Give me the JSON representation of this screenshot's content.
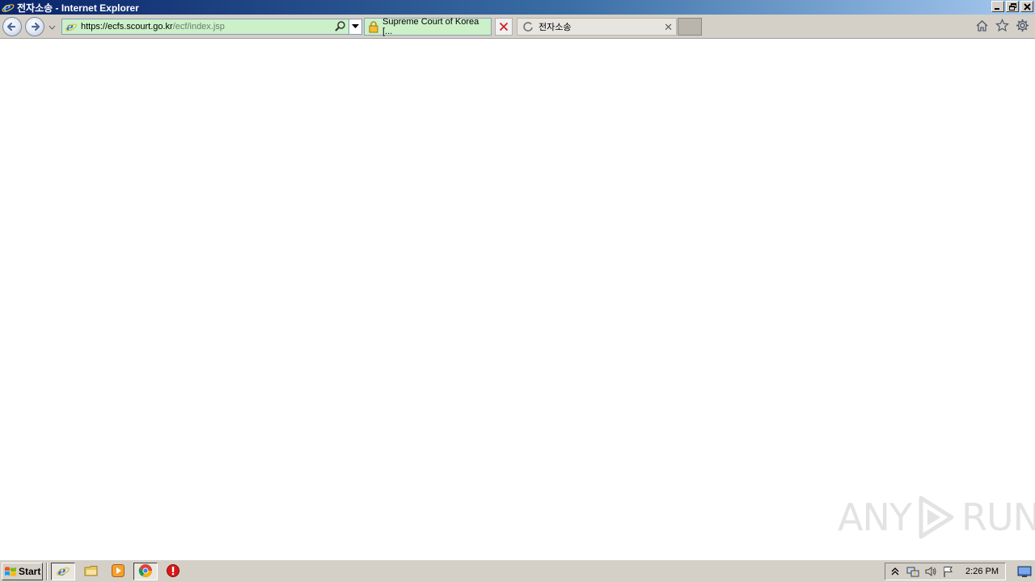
{
  "window": {
    "title": "전자소송 - Internet Explorer"
  },
  "address": {
    "url_host": "https://ecfs.scourt.go.kr",
    "url_path": "/ecf/index.jsp"
  },
  "tabs": [
    {
      "label": "Supreme Court of Korea [...",
      "state": "active"
    },
    {
      "label": "전자소송",
      "state": "loading"
    }
  ],
  "watermark": {
    "left_text": "ANY",
    "right_text": "RUN"
  },
  "taskbar": {
    "start_label": "Start",
    "clock": "2:26 PM",
    "apps": [
      "internet-explorer-icon",
      "file-explorer-icon",
      "media-player-icon",
      "chrome-icon",
      "stop-icon"
    ]
  },
  "colors": {
    "address_bg": "#ccf0c8",
    "titlebar_start": "#0a246a",
    "titlebar_end": "#a6caf0",
    "chrome_gray": "#d4d0c8"
  }
}
